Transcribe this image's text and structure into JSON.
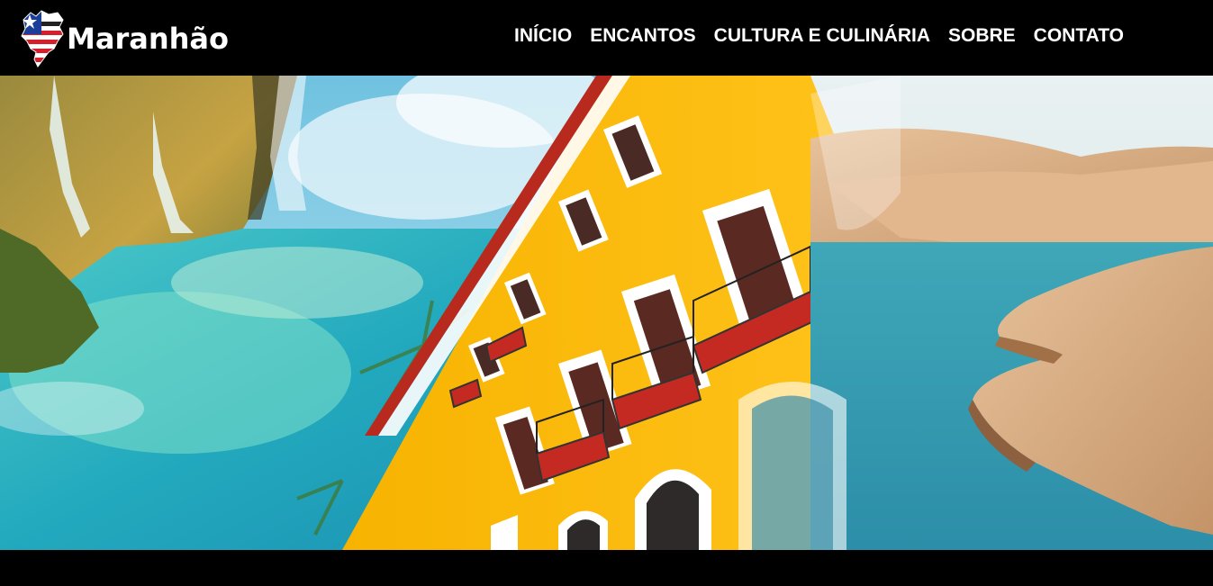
{
  "brand": {
    "name": "Maranhão",
    "icon": "maranhao-flag-map-icon"
  },
  "nav": {
    "items": [
      {
        "label": "INÍCIO"
      },
      {
        "label": "ENCANTOS"
      },
      {
        "label": "CULTURA E CULINÁRIA"
      },
      {
        "label": "SOBRE"
      },
      {
        "label": "CONTATO"
      }
    ]
  },
  "hero": {
    "image": "hero-collage-waterfall-colonial-building-sand-dunes"
  },
  "colors": {
    "background": "#000000",
    "nav_text": "#ffffff",
    "building_yellow": "#f5b400",
    "water_turquoise": "#2fb3c6",
    "dune_sand": "#d9ab7e",
    "flag_red": "#d4202a",
    "flag_blue": "#1b3f99"
  }
}
